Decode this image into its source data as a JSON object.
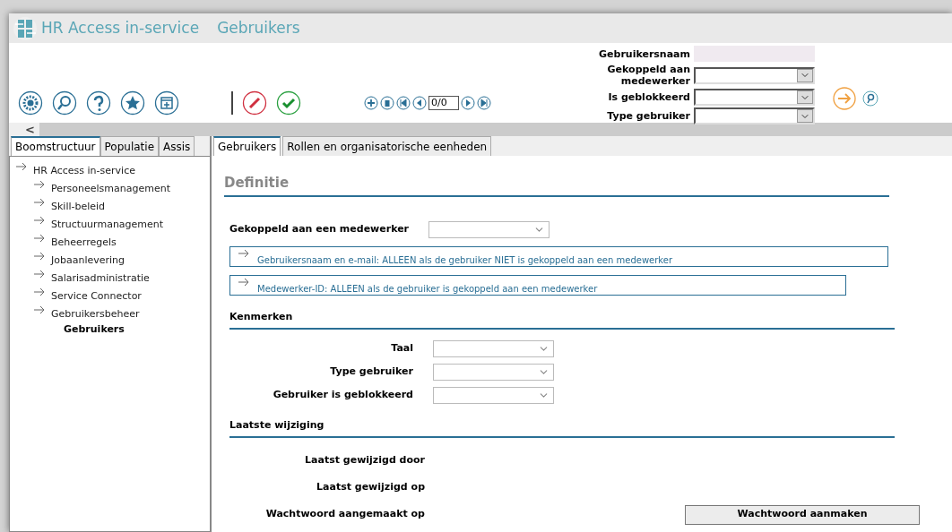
{
  "window": {
    "app_title": "HR Access in-service",
    "page_title": "Gebruikers"
  },
  "toolbar": {
    "record_counter": "0/0"
  },
  "filters": [
    {
      "label": "Gebruikersnaam",
      "kind": "text"
    },
    {
      "label": "Gekoppeld aan medewerker",
      "kind": "select"
    },
    {
      "label": "Is geblokkeerd",
      "kind": "select"
    },
    {
      "label": "Type gebruiker",
      "kind": "select"
    }
  ],
  "collapse": {
    "label": "<"
  },
  "left_tabs": [
    {
      "label": "Boomstructuur",
      "selected": true
    },
    {
      "label": "Populatie",
      "selected": false
    },
    {
      "label": "Assis",
      "selected": false
    }
  ],
  "right_tabs": [
    {
      "label": "Gebruikers",
      "selected": true
    },
    {
      "label": "Rollen en organisatorische eenheden",
      "selected": false
    }
  ],
  "tree": {
    "label": "HR Access in-service",
    "children": [
      {
        "label": "Personeelsmanagement"
      },
      {
        "label": "Skill-beleid"
      },
      {
        "label": "Structuurmanagement"
      },
      {
        "label": "Beheerregels"
      },
      {
        "label": "Jobaanlevering"
      },
      {
        "label": "Salarisadministratie"
      },
      {
        "label": "Service Connector"
      },
      {
        "label": "Gebruikersbeheer",
        "children": [
          {
            "label": "Gebruikers",
            "selected": true
          }
        ]
      }
    ]
  },
  "definition": {
    "title": "Definitie",
    "linked_label": "Gekoppeld aan een medewerker",
    "panels": [
      {
        "label": "Gebruikersnaam en e-mail: ALLEEN als de gebruiker NIET is gekoppeld aan een medewerker"
      },
      {
        "label": "Medewerker-ID: ALLEEN als de gebruiker is gekoppeld aan een medewerker"
      }
    ]
  },
  "characteristics": {
    "title": "Kenmerken",
    "fields": [
      {
        "label": "Taal"
      },
      {
        "label": "Type gebruiker"
      },
      {
        "label": "Gebruiker is geblokkeerd"
      }
    ]
  },
  "last_change": {
    "title": "Laatste wijziging",
    "rows": [
      {
        "label": "Laatst gewijzigd door"
      },
      {
        "label": "Laatst gewijzigd op"
      },
      {
        "label": "Wachtwoord aangemaakt op",
        "button": "Wachtwoord aanmaken"
      }
    ]
  }
}
